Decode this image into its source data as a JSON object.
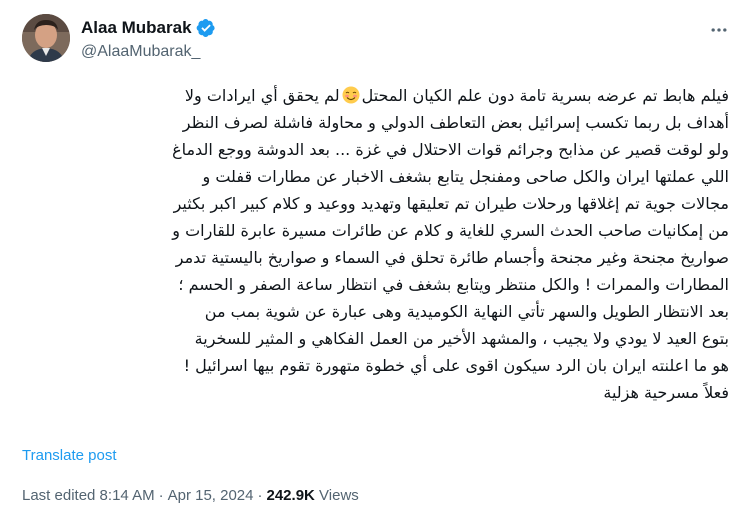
{
  "author": {
    "display_name": "Alaa Mubarak",
    "handle": "@AlaaMubarak_",
    "verified": true,
    "avatar_icon": "user-avatar"
  },
  "tweet": {
    "lines": [
      "فيلم هابط تم عرضه بسرية تامة دون علم الكيان المحتل",
      "أهداف بل ربما تكسب إسرائيل بعض التعاطف الدولي و محاولة فاشلة لصرف النظر",
      "ولو لوقت قصير عن مذابح وجرائم قوات الاحتلال في غزة ... بعد الدوشة ووجع الدماغ",
      "اللي عملتها ايران والكل صاحى ومفنجل يتابع بشغف الاخبار عن مطارات قفلت و",
      "مجالات جوية تم إغلاقها ورحلات طيران تم تعليقها وتهديد ووعيد و كلام كبير اكبر بكثير",
      "من إمكانيات صاحب الحدث السري للغاية و كلام عن طائرات مسيرة عابرة للقارات و",
      "صواريخ مجنحة وغير مجنحة وأجسام طائرة تحلق في السماء و صواريخ باليستية تدمر",
      "المطارات والممرات ! والكل منتظر ويتابع بشغف في انتظار ساعة الصفر و الحسم ؛",
      "بعد الانتظار الطويل والسهر تأتي النهاية الكوميدية وهى عبارة عن شوية بمب من",
      "بتوع العيد لا يودي ولا يجيب ، والمشهد الأخير من العمل الفكاهي و المثير للسخرية",
      "هو ما اعلنته ايران بان الرد سيكون اقوى على أي خطوة متهورة تقوم بيها اسرائيل !",
      "فعلاً مسرحية هزلية"
    ],
    "line1_suffix": "لم يحقق أي ايرادات ولا",
    "emoji": "smiling-face-emoji"
  },
  "actions": {
    "translate_label": "Translate post",
    "more_icon": "more-horizontal-icon"
  },
  "meta": {
    "edited_label": "Last edited 8:14 AM",
    "date": "Apr 15, 2024",
    "views_count": "242.9K",
    "views_label": "Views",
    "separator": "·"
  },
  "colors": {
    "accent": "#1d9bf0",
    "secondary_text": "#536471",
    "primary_text": "#0f1419"
  }
}
